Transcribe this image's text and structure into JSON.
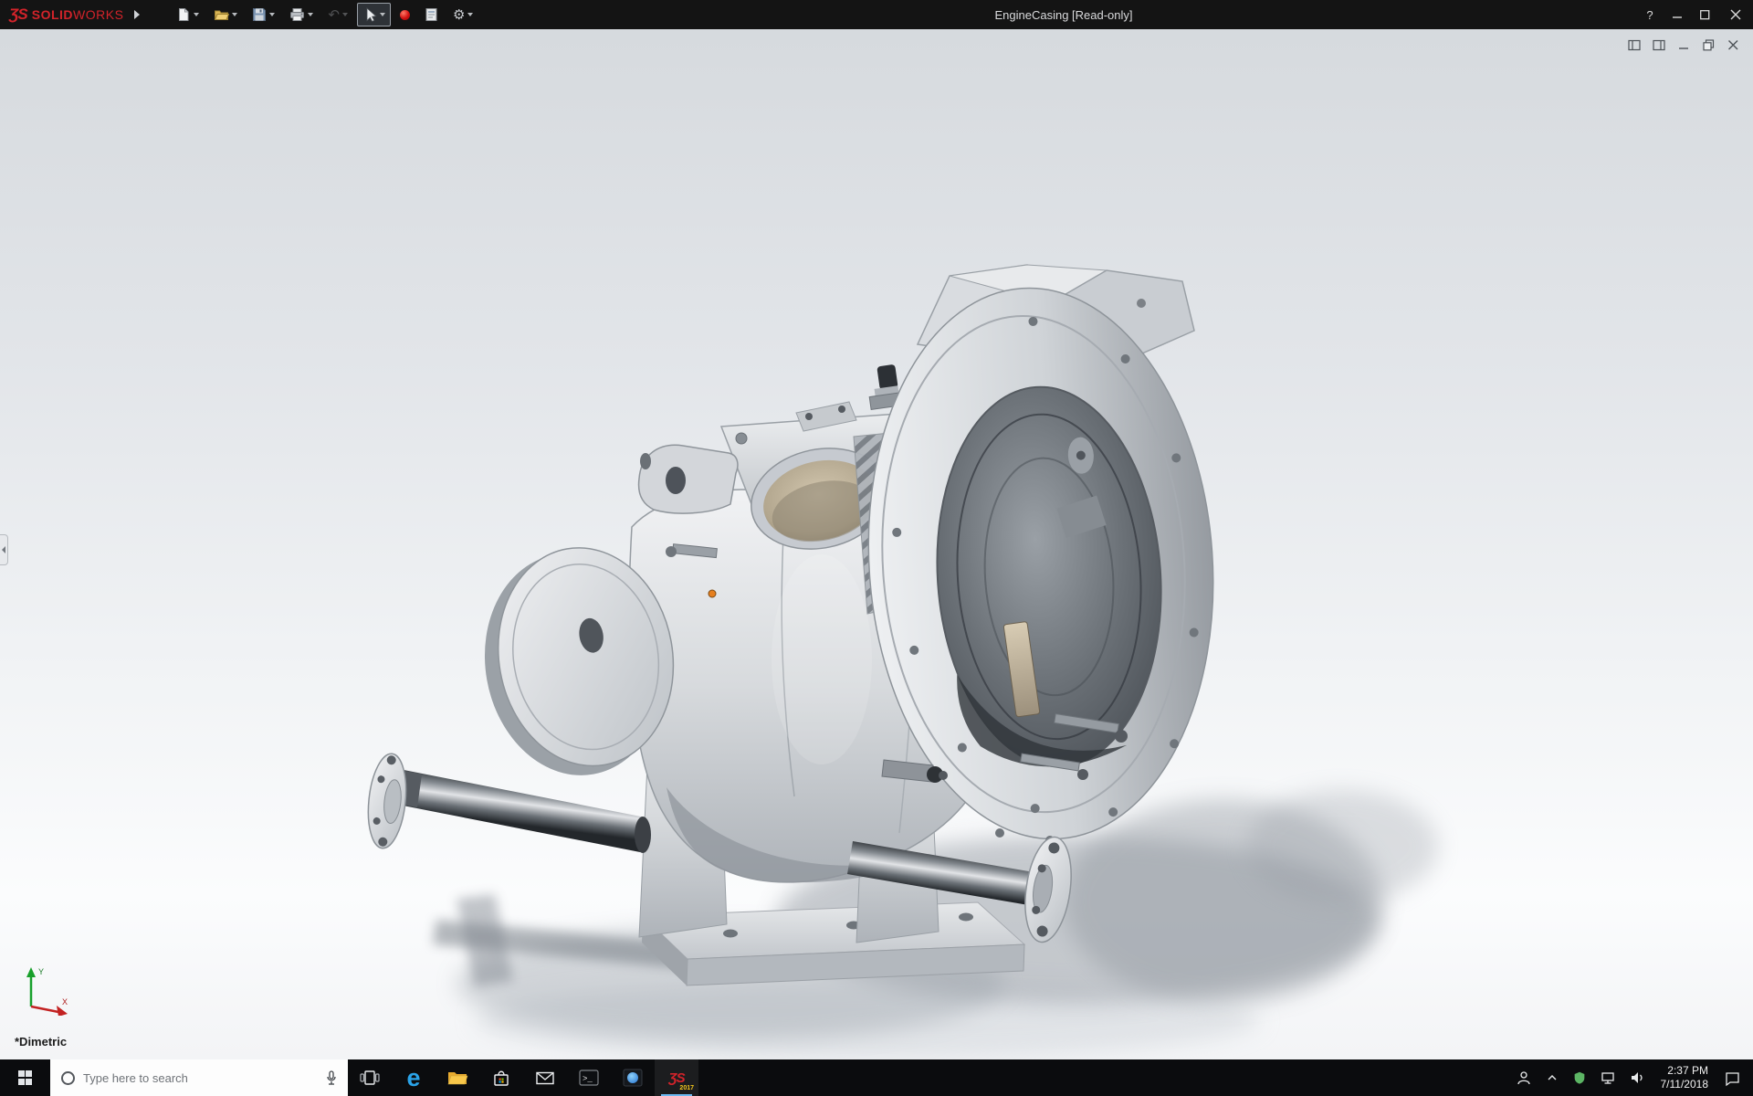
{
  "title_bar": {
    "brand_mark": "ƷS",
    "brand_solid": "SOLID",
    "brand_works": "WORKS",
    "document_title": "EngineCasing [Read-only]",
    "help_label": "?"
  },
  "toolbar": {
    "buttons": [
      "flyout",
      "new",
      "open",
      "save",
      "print",
      "undo",
      "select",
      "macro-record",
      "file-properties",
      "options"
    ],
    "active_button": "select",
    "disabled_button": "undo"
  },
  "document_window": {
    "controls": [
      "pane-float",
      "pane-dock",
      "minimize",
      "restore",
      "close"
    ]
  },
  "viewport": {
    "orientation_label": "*Dimetric",
    "axis_x_label": "X",
    "axis_y_label": "Y"
  },
  "taskbar": {
    "search_placeholder": "Type here to search",
    "console_glyph": ">_",
    "edge_glyph": "e",
    "solidworks_mark": "ƷS",
    "solidworks_badge": "2017",
    "tray_time": "2:37 PM",
    "tray_date": "7/11/2018"
  },
  "colors": {
    "brand_red": "#d2232a",
    "selection_orange": "#e67f1e",
    "titlebar_bg": "#141414",
    "taskbar_bg": "#0b0c0e",
    "viewport_top": "#d6dade",
    "viewport_bottom": "#fbfcfd"
  }
}
